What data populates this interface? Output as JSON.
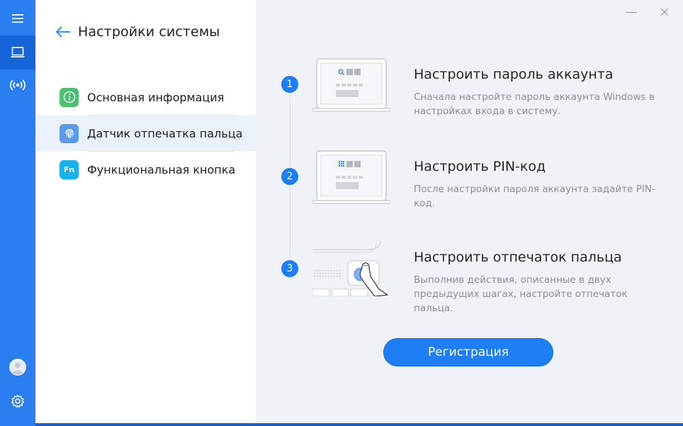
{
  "rail": {
    "items": [
      {
        "icon": "menu-icon"
      },
      {
        "icon": "laptop-icon"
      },
      {
        "icon": "wireless-icon"
      }
    ],
    "bottom": [
      {
        "icon": "avatar-icon"
      },
      {
        "icon": "gear-icon"
      }
    ]
  },
  "nav": {
    "title": "Настройки системы",
    "items": [
      {
        "label": "Основная информация",
        "icon": "info-icon",
        "color": "#4cbf73"
      },
      {
        "label": "Датчик отпечатка пальца",
        "icon": "fingerprint-icon",
        "color": "#5b9ce8"
      },
      {
        "label": "Функциональная кнопка",
        "icon": "fn-icon",
        "icon_text": "Fn",
        "color": "#19b2e8"
      }
    ]
  },
  "steps": [
    {
      "number": "1",
      "title": "Настроить пароль аккаунта",
      "desc": "Сначала настройте пароль аккаунта Windows в настройках входа в систему."
    },
    {
      "number": "2",
      "title": "Настроить PIN-код",
      "desc": "После настройки пароля аккаунта задайте PIN-код."
    },
    {
      "number": "3",
      "title": "Настроить отпечаток пальца",
      "desc": "Выполнив действия, описанные в двух предыдущих шагах, настройте отпечаток пальца."
    }
  ],
  "register_button": "Регистрация",
  "colors": {
    "accent": "#1e7ef6",
    "rail": "#2a7ef0",
    "main_bg": "#eff2f7"
  }
}
